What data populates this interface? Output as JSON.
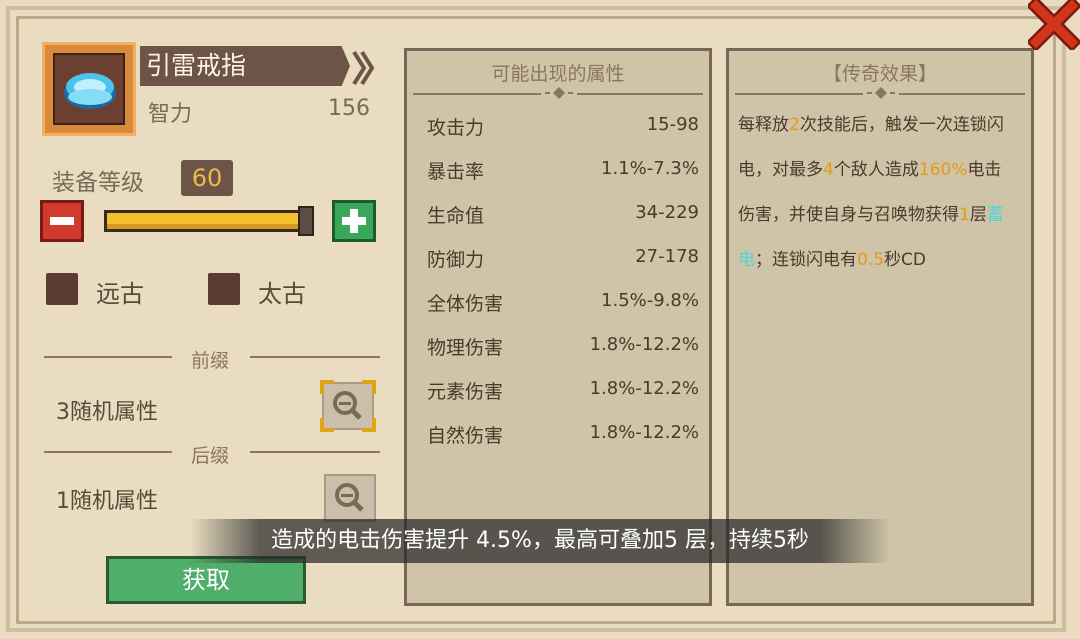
{
  "item": {
    "name": "引雷戒指",
    "stat_name": "智力",
    "stat_value": "156",
    "icon": "blue-ring-icon"
  },
  "level": {
    "label": "装备等级",
    "value": "60",
    "progress": 1.0
  },
  "checkboxes": [
    {
      "label": "远古"
    },
    {
      "label": "太古"
    }
  ],
  "prefix": {
    "label": "前缀",
    "text": "3随机属性"
  },
  "suffix": {
    "label": "后缀",
    "text": "1随机属性"
  },
  "get_button": "获取",
  "attributes_panel": {
    "title": "可能出现的属性",
    "rows": [
      {
        "name": "攻击力",
        "value": "15-98"
      },
      {
        "name": "暴击率",
        "value": "1.1%-7.3%"
      },
      {
        "name": "生命值",
        "value": "34-229"
      },
      {
        "name": "防御力",
        "value": "27-178"
      },
      {
        "name": "全体伤害",
        "value": "1.5%-9.8%"
      },
      {
        "name": "物理伤害",
        "value": "1.8%-12.2%"
      },
      {
        "name": "元素伤害",
        "value": "1.8%-12.2%"
      },
      {
        "name": "自然伤害",
        "value": "1.8%-12.2%"
      }
    ]
  },
  "legend_panel": {
    "title": "【传奇效果】",
    "segments": [
      {
        "t": "每释放",
        "c": ""
      },
      {
        "t": "2",
        "c": "orange"
      },
      {
        "t": "次技能后，触发一次连锁闪电，对最多",
        "c": ""
      },
      {
        "t": "4",
        "c": "orange"
      },
      {
        "t": "个敌人造成",
        "c": ""
      },
      {
        "t": "160%",
        "c": "orange"
      },
      {
        "t": "电击伤害，并使自身与召唤物获得",
        "c": ""
      },
      {
        "t": "1",
        "c": "orange"
      },
      {
        "t": "层",
        "c": ""
      },
      {
        "t": "蓄电",
        "c": "cyan"
      },
      {
        "t": "；连锁闪电有",
        "c": ""
      },
      {
        "t": "0.5",
        "c": "orange"
      },
      {
        "t": "秒CD",
        "c": ""
      }
    ]
  },
  "subtitle": "造成的电击伤害提升 4.5%，最高可叠加5 层，持续5秒",
  "colors": {
    "orange": "#e49a1a",
    "cyan": "#4ed6d6",
    "close": "#d2341c"
  }
}
